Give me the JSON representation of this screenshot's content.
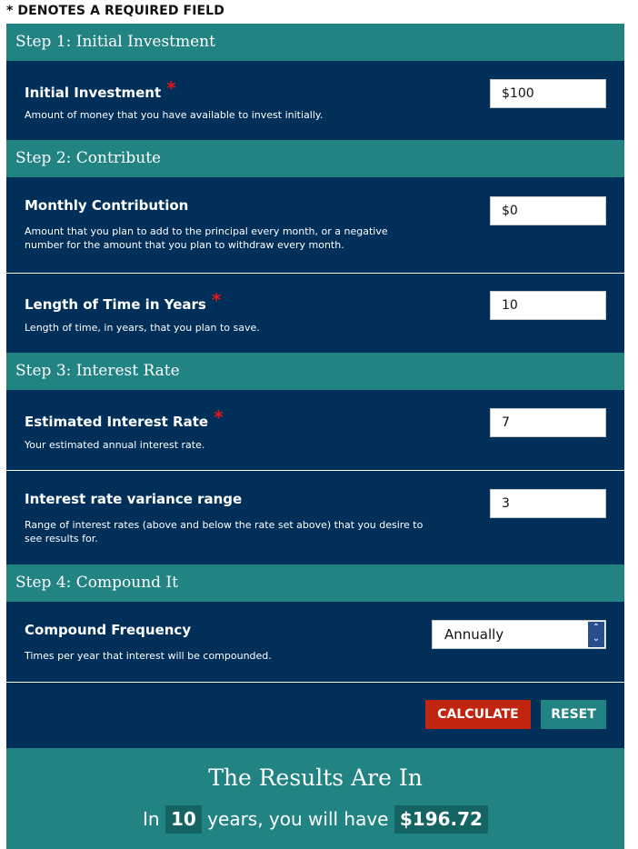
{
  "required_note": "* DENOTES A REQUIRED FIELD",
  "steps": [
    {
      "header": "Step 1: Initial Investment",
      "rows": [
        {
          "label": "Initial Investment",
          "required": "*",
          "desc": "Amount of money that you have available to invest initially.",
          "value": "$100"
        }
      ]
    },
    {
      "header": "Step 2: Contribute",
      "rows": [
        {
          "label": "Monthly Contribution",
          "required": "",
          "desc": "Amount that you plan to add to the principal every month, or a negative number for the amount that you plan to withdraw every month.",
          "value": "$0"
        },
        {
          "label": "Length of Time in Years",
          "required": "*",
          "desc": "Length of time, in years, that you plan to save.",
          "value": "10"
        }
      ]
    },
    {
      "header": "Step 3: Interest Rate",
      "rows": [
        {
          "label": "Estimated Interest Rate",
          "required": "*",
          "desc": "Your estimated annual interest rate.",
          "value": "7"
        },
        {
          "label": "Interest rate variance range",
          "required": "",
          "desc": "Range of interest rates (above and below the rate set above) that you desire to see results for.",
          "value": "3"
        }
      ]
    },
    {
      "header": "Step 4: Compound It",
      "rows": [
        {
          "label": "Compound Frequency",
          "required": "",
          "desc": "Times per year that interest will be compounded.",
          "value": "Annually"
        }
      ]
    }
  ],
  "buttons": {
    "calculate": "CALCULATE",
    "reset": "RESET"
  },
  "results": {
    "title": "The Results Are In",
    "prefix": "In",
    "years": "10",
    "middle": "years, you will have",
    "amount": "$196.72"
  },
  "colors": {
    "teal": "#228383",
    "navy": "#00305a",
    "red": "#c1250f",
    "required": "#e0161b"
  }
}
